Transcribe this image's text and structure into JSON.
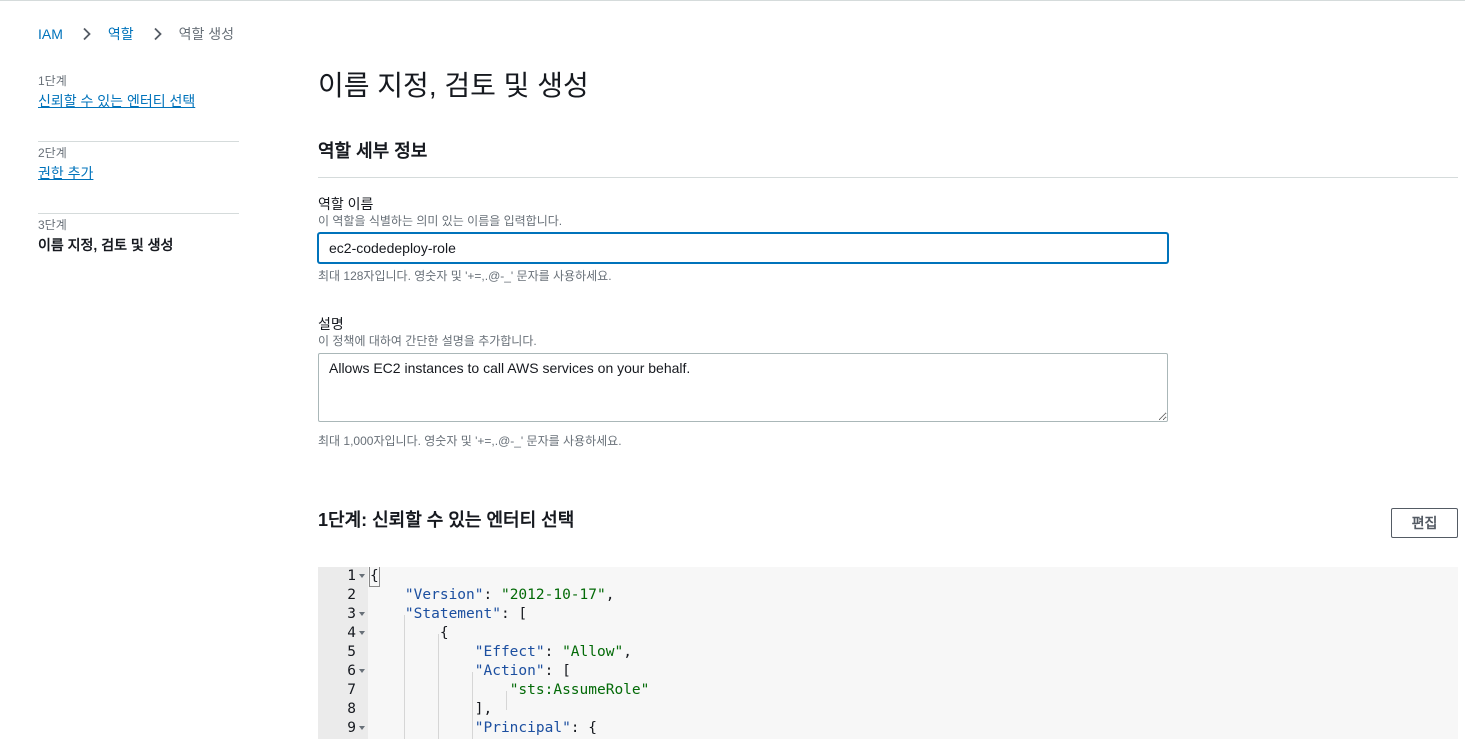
{
  "breadcrumb": {
    "items": [
      "IAM",
      "역할"
    ],
    "current": "역할 생성"
  },
  "steps": [
    {
      "number": "1단계",
      "label": "신뢰할 수 있는 엔터티 선택"
    },
    {
      "number": "2단계",
      "label": "권한 추가"
    },
    {
      "number": "3단계",
      "label": "이름 지정, 검토 및 생성"
    }
  ],
  "page": {
    "title": "이름 지정, 검토 및 생성",
    "section_title": "역할 세부 정보"
  },
  "role_name": {
    "label": "역할 이름",
    "hint": "이 역할을 식별하는 의미 있는 이름을 입력합니다.",
    "value": "ec2-codedeploy-role",
    "constraint": "최대 128자입니다. 영숫자 및 '+=,.@-_' 문자를 사용하세요."
  },
  "description": {
    "label": "설명",
    "hint": "이 정책에 대하여 간단한 설명을 추가합니다.",
    "value": "Allows EC2 instances to call AWS services on your behalf.",
    "constraint": "최대 1,000자입니다. 영숫자 및 '+=,.@-_' 문자를 사용하세요."
  },
  "trust_section": {
    "title": "1단계: 신뢰할 수 있는 엔터티 선택",
    "edit_label": "편집"
  },
  "policy_editor": {
    "line_numbers": [
      "1",
      "2",
      "3",
      "4",
      "5",
      "6",
      "7",
      "8",
      "9"
    ],
    "tokens": {
      "open_brace": "{",
      "version_key": "\"Version\"",
      "version_value": "\"2012-10-17\"",
      "statement_key": "\"Statement\"",
      "effect_key": "\"Effect\"",
      "effect_value": "\"Allow\"",
      "action_key": "\"Action\"",
      "action_value": "\"sts:AssumeRole\"",
      "principal_key": "\"Principal\""
    }
  }
}
